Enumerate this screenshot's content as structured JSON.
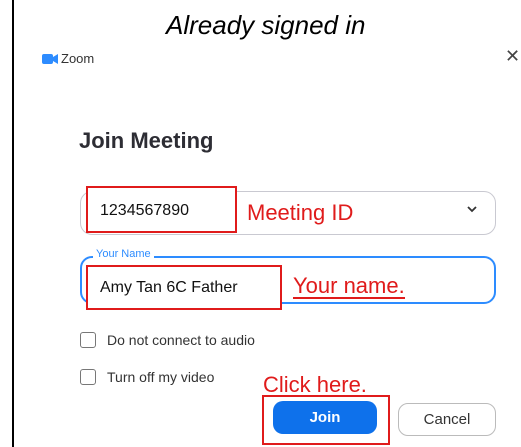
{
  "caption": "Already signed in",
  "window": {
    "app_name": "Zoom",
    "close_icon": "close-icon",
    "logo_icon": "zoom-logo-icon"
  },
  "dialog": {
    "title": "Join Meeting",
    "meeting_id": {
      "value": "1234567890",
      "dropdown_icon": "chevron-down-icon"
    },
    "your_name": {
      "legend": "Your Name",
      "value": "Amy Tan 6C Father"
    },
    "options": [
      {
        "label": "Do not connect to audio",
        "checked": false
      },
      {
        "label": "Turn off my video",
        "checked": false
      }
    ],
    "join_label": "Join",
    "cancel_label": "Cancel"
  },
  "annotations": {
    "meeting_id": "Meeting ID",
    "your_name": "Your name.",
    "click_here": "Click here."
  },
  "colors": {
    "accent": "#0e71eb",
    "focus": "#2d8cff",
    "annotation": "#e01b1b"
  }
}
